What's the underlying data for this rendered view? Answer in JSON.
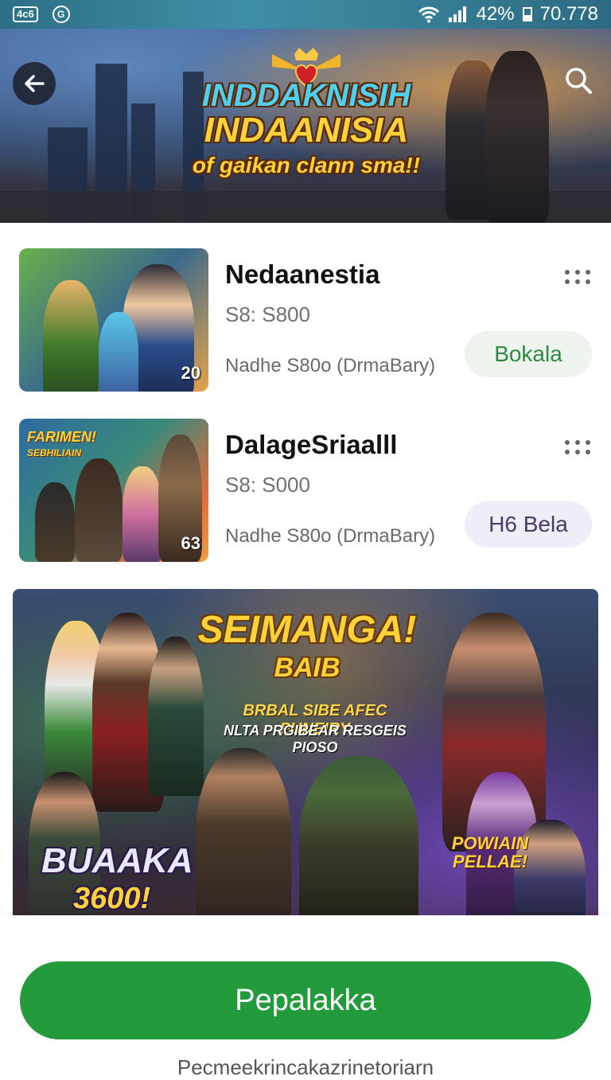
{
  "status_bar": {
    "icon_box_text": "4c6",
    "icon_circle_text": "G",
    "battery_percent": "42%",
    "time": "70.778"
  },
  "header": {
    "title_line1": "INDDAKNISIH",
    "title_line2": "INDAANISIA",
    "tagline": "of gaikan clann sma!!",
    "back_icon": "arrow-left-icon",
    "search_icon": "search-icon"
  },
  "games": [
    {
      "title": "Nedaanestia",
      "price": "S8: S800",
      "meta": "Nadhe S80o  (DrmaBary)",
      "button_label": "Bokala",
      "badge": "20",
      "button_bg": "#eef3ee",
      "button_color": "#2e8a3e"
    },
    {
      "title": "DalageSriaalll",
      "price": "S8: S000",
      "meta": "Nadhe S80o  (DrmaBary)",
      "button_label": "H6 Bela",
      "badge": "63",
      "thumb_text_1": "FARIMEN!",
      "thumb_text_2": "SEBHILIAIN",
      "button_bg": "#efedf5",
      "button_color": "#4a3a6a"
    }
  ],
  "promo": {
    "title_1": "SEIMANGA!",
    "title_2": "BAIB",
    "subtitle_1": "BRBAL SIBE AFEC PUNEIRY",
    "subtitle_2": "NLTA PRGIBEAR RESGEIS PIOSO",
    "corner_1": "BUAAKA",
    "corner_2": "3600!",
    "corner_right": "POWIAIN PELLAE!"
  },
  "cta": {
    "label": "Pepalakka"
  },
  "footer": {
    "text": "Pecmeekrincakazrinetoriarn"
  },
  "colors": {
    "accent": "#239a3b",
    "status_bar": "#2c6f86"
  }
}
